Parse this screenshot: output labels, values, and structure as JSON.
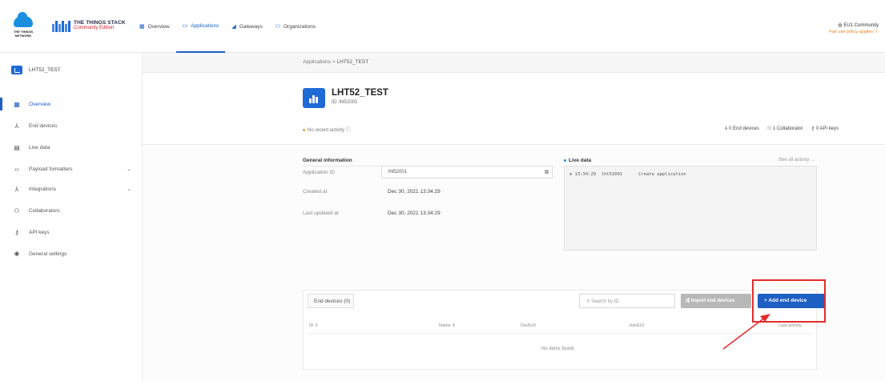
{
  "brand": {
    "ttn_text": "THE THINGS NETWORK",
    "tts_name": "THE THINGS STACK",
    "tts_edition": "Community Edition"
  },
  "nav": [
    {
      "label": "Overview",
      "icon": "grid-icon"
    },
    {
      "label": "Applications",
      "icon": "applications-icon",
      "active": true
    },
    {
      "label": "Gateways",
      "icon": "gateway-icon"
    },
    {
      "label": "Organizations",
      "icon": "organizations-icon"
    }
  ],
  "account": {
    "cluster": "EU1 Community",
    "notice": "Fair use policy applies"
  },
  "sidebar": {
    "app_name": "LHT52_TEST",
    "items": [
      {
        "label": "Overview",
        "icon": "grid-icon",
        "active": true
      },
      {
        "label": "End devices",
        "icon": "devices-icon"
      },
      {
        "label": "Live data",
        "icon": "live-data-icon"
      },
      {
        "label": "Payload formatters",
        "icon": "code-icon",
        "has_chevron": true
      },
      {
        "label": "Integrations",
        "icon": "integrations-icon",
        "has_chevron": true
      },
      {
        "label": "Collaborators",
        "icon": "collaborators-icon"
      },
      {
        "label": "API keys",
        "icon": "key-icon"
      },
      {
        "label": "General settings",
        "icon": "gear-icon"
      }
    ]
  },
  "breadcrumb": {
    "root": "Applications",
    "separator": ">",
    "current": "LHT52_TEST"
  },
  "app": {
    "title": "LHT52_TEST",
    "id_text": "ID: lht52001",
    "recent_activity": "No recent activity",
    "stats": {
      "end_devices": "0 End devices",
      "collaborators": "1 Collaborator",
      "api_keys": "0 API keys"
    }
  },
  "general": {
    "title": "General information",
    "app_id_label": "Application ID",
    "app_id_value": "lht52001",
    "created_label": "Created at",
    "created_value": "Dec 30, 2021 13:34:29",
    "updated_label": "Last updated at",
    "updated_value": "Dec 30, 2021 13:34:29"
  },
  "live_data": {
    "title": "Live data",
    "see_all": "See all activity →",
    "rows": [
      {
        "time": "13:34:29",
        "id": "lht52001",
        "event": "Create application"
      }
    ]
  },
  "end_devices": {
    "tab_label": "End devices (0)",
    "search_placeholder": "Search by ID",
    "import_label": "Import end devices",
    "add_label": "+ Add end device",
    "columns": [
      "ID",
      "Name",
      "DevEUI",
      "JoinEUI",
      "Last activity"
    ],
    "empty_text": "No items found"
  },
  "colors": {
    "primary": "#1e5fc4",
    "highlight": "#e52b2b",
    "import_disabled": "#b8b8b8"
  }
}
